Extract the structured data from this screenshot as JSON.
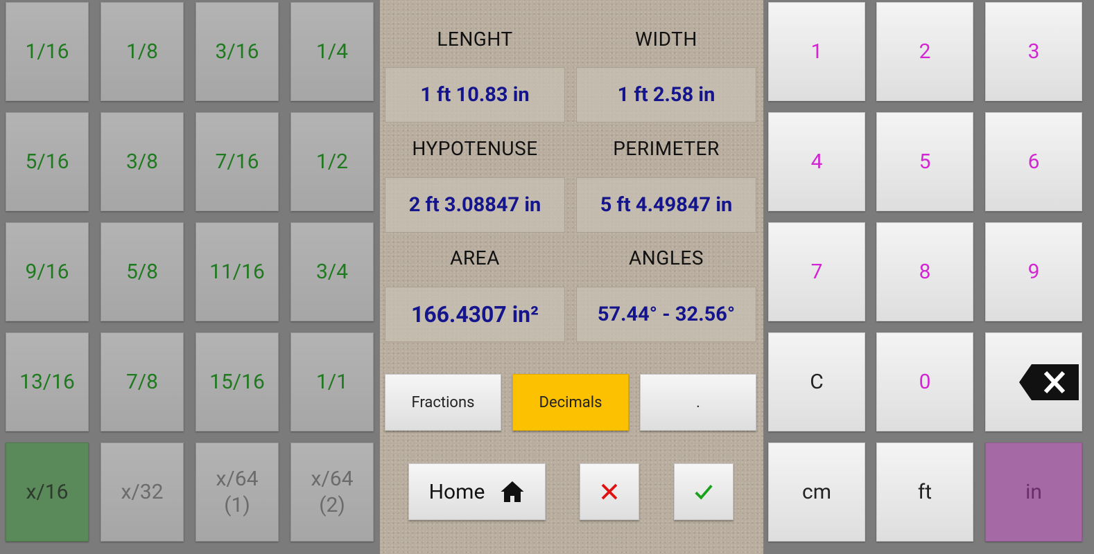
{
  "fractions": {
    "keys": [
      "1/16",
      "1/8",
      "3/16",
      "1/4",
      "5/16",
      "3/8",
      "7/16",
      "1/2",
      "9/16",
      "5/8",
      "11/16",
      "3/4",
      "13/16",
      "7/8",
      "15/16",
      "1/1"
    ],
    "modes": [
      "x/16",
      "x/32",
      "x/64\n(1)",
      "x/64\n(2)"
    ],
    "active_mode": "x/16",
    "colors": {
      "key_text": "#1f7a1f",
      "active_mode_bg": "#5a8a5a"
    }
  },
  "results": {
    "length_label": "LENGHT",
    "width_label": "WIDTH",
    "hypotenuse_label": "HYPOTENUSE",
    "perimeter_label": "PERIMETER",
    "area_label": "AREA",
    "angles_label": "ANGLES",
    "length_value": "1 ft 10.83 in",
    "width_value": "1 ft 2.58 in",
    "hypotenuse_value": "2 ft 3.08847 in",
    "perimeter_value": "5 ft 4.49847 in",
    "area_value": "166.4307 in²",
    "angles_value": "57.44° - 32.56°",
    "value_color": "#14148c"
  },
  "toggles": {
    "fractions_label": "Fractions",
    "decimals_label": "Decimals",
    "dot_label": ".",
    "selected": "Decimals",
    "selected_color": "#fcc100"
  },
  "actions": {
    "home_label": "Home",
    "home_icon": "home-icon",
    "cancel_icon": "close-icon",
    "confirm_icon": "check-icon"
  },
  "keypad": {
    "digits": [
      "1",
      "2",
      "3",
      "4",
      "5",
      "6",
      "7",
      "8",
      "9"
    ],
    "clear_label": "C",
    "zero_label": "0",
    "backspace_icon": "backspace-icon",
    "units": [
      "cm",
      "ft",
      "in"
    ],
    "active_unit": "in",
    "digit_color": "#d326d3",
    "active_unit_color": "#a56aa5"
  }
}
